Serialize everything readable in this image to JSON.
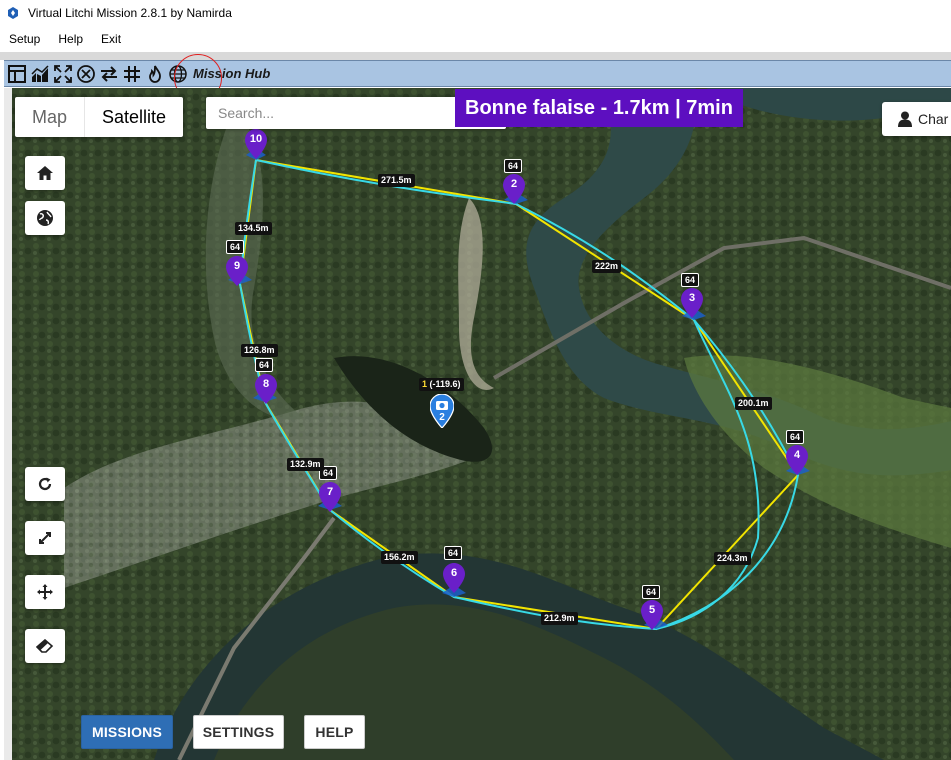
{
  "window": {
    "title": "Virtual Litchi Mission 2.8.1 by Namirda"
  },
  "menu": {
    "items": [
      "Setup",
      "Help",
      "Exit"
    ]
  },
  "toolbar": {
    "icons": [
      "table-icon",
      "chart-icon",
      "expand-icon",
      "cancel-icon",
      "swap-icon",
      "grid-icon",
      "fire-icon",
      "globe-icon"
    ],
    "mission_hub_label": "Mission Hub"
  },
  "map": {
    "tabs": {
      "map": "Map",
      "satellite": "Satellite",
      "active": "Satellite"
    },
    "search_placeholder": "Search...",
    "mission_title": "Bonne falaise - 1.7km | 7min",
    "change_button": "Char",
    "colors": {
      "title_bg": "#5d0fc0",
      "marker": "#6a1fc9",
      "path_yellow": "#f2e400",
      "path_cyan": "#38d9e6",
      "primary_button": "#2e6eb5"
    }
  },
  "waypoints": [
    {
      "num": "10",
      "altitude": ""
    },
    {
      "num": "2",
      "altitude": "64"
    },
    {
      "num": "3",
      "altitude": "64"
    },
    {
      "num": "4",
      "altitude": "64"
    },
    {
      "num": "5",
      "altitude": "64"
    },
    {
      "num": "6",
      "altitude": "64"
    },
    {
      "num": "7",
      "altitude": "64"
    },
    {
      "num": "8",
      "altitude": "64"
    },
    {
      "num": "9",
      "altitude": "64"
    }
  ],
  "segment_distances": [
    "271.5m",
    "222m",
    "200.1m",
    "224.3m",
    "212.9m",
    "156.2m",
    "132.9m",
    "126.8m",
    "134.5m"
  ],
  "poi": {
    "num": "1",
    "heading": "(-119.6)",
    "marker_num": "2"
  },
  "buttons": {
    "missions": "MISSIONS",
    "settings": "SETTINGS",
    "help": "HELP"
  }
}
